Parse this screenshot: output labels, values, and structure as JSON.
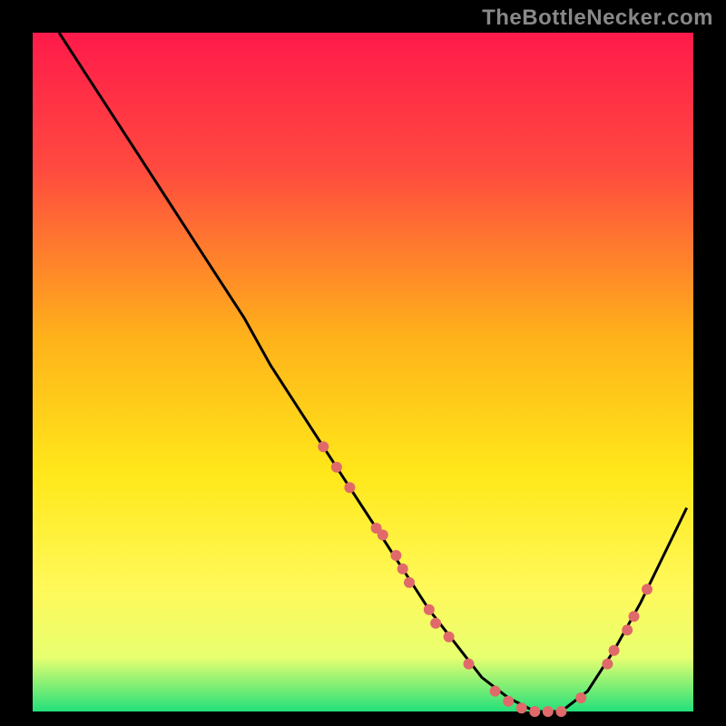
{
  "watermark": "TheBottleNecker.com",
  "chart_data": {
    "type": "line",
    "title": "",
    "xlabel": "",
    "ylabel": "",
    "xlim": [
      0,
      100
    ],
    "ylim": [
      0,
      100
    ],
    "background_gradient": {
      "stops": [
        {
          "offset": 0,
          "color": "#ff1a4b"
        },
        {
          "offset": 20,
          "color": "#ff4a3f"
        },
        {
          "offset": 45,
          "color": "#ffb21a"
        },
        {
          "offset": 65,
          "color": "#ffe81a"
        },
        {
          "offset": 82,
          "color": "#fff95a"
        },
        {
          "offset": 92,
          "color": "#e8ff70"
        },
        {
          "offset": 100,
          "color": "#23e07a"
        }
      ]
    },
    "series": [
      {
        "name": "bottleneck-curve",
        "color": "#000000",
        "x": [
          4,
          8,
          12,
          16,
          20,
          24,
          28,
          32,
          36,
          40,
          44,
          48,
          52,
          56,
          60,
          64,
          68,
          72,
          76,
          80,
          84,
          88,
          92,
          96,
          99
        ],
        "y": [
          100,
          94,
          88,
          82,
          76,
          70,
          64,
          58,
          51,
          45,
          39,
          33,
          27,
          21,
          15,
          10,
          5,
          2,
          0,
          0,
          3,
          9,
          16,
          24,
          30
        ]
      }
    ],
    "points": {
      "name": "sample-points",
      "color": "#e06a6a",
      "radius": 6,
      "data": [
        {
          "x": 44,
          "y": 39
        },
        {
          "x": 46,
          "y": 36
        },
        {
          "x": 48,
          "y": 33
        },
        {
          "x": 52,
          "y": 27
        },
        {
          "x": 53,
          "y": 26
        },
        {
          "x": 55,
          "y": 23
        },
        {
          "x": 56,
          "y": 21
        },
        {
          "x": 57,
          "y": 19
        },
        {
          "x": 60,
          "y": 15
        },
        {
          "x": 61,
          "y": 13
        },
        {
          "x": 63,
          "y": 11
        },
        {
          "x": 66,
          "y": 7
        },
        {
          "x": 70,
          "y": 3
        },
        {
          "x": 72,
          "y": 1.5
        },
        {
          "x": 74,
          "y": 0.5
        },
        {
          "x": 76,
          "y": 0
        },
        {
          "x": 78,
          "y": 0
        },
        {
          "x": 80,
          "y": 0
        },
        {
          "x": 83,
          "y": 2
        },
        {
          "x": 87,
          "y": 7
        },
        {
          "x": 88,
          "y": 9
        },
        {
          "x": 90,
          "y": 12
        },
        {
          "x": 91,
          "y": 14
        },
        {
          "x": 93,
          "y": 18
        }
      ]
    }
  }
}
